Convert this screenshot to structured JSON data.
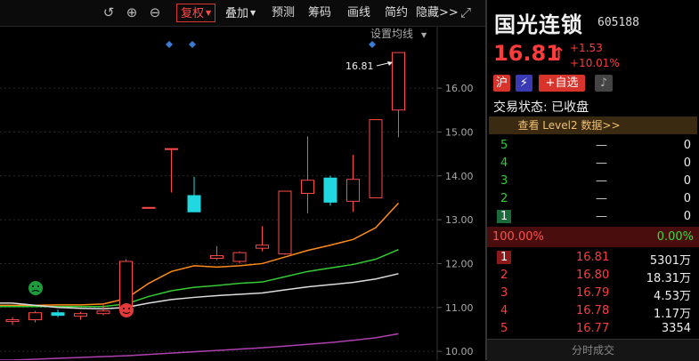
{
  "toolbar": {
    "icons": [
      "undo-icon",
      "zoom-in-icon",
      "zoom-out-icon"
    ],
    "items": [
      "复权",
      "叠加",
      "预测",
      "筹码",
      "画线",
      "简约",
      "隐藏>>"
    ],
    "active": "复权"
  },
  "chart": {
    "setting_label": "设置均线",
    "last_price_label": "16.81",
    "y_ticks": [
      "16.00",
      "15.00",
      "14.00",
      "13.00",
      "12.00",
      "11.00",
      "10.00"
    ]
  },
  "chart_data": {
    "type": "candlestick",
    "y_ticks": [
      16.0,
      15.0,
      14.0,
      13.0,
      12.0,
      11.0,
      10.0
    ],
    "ylim": [
      9.8,
      17.4
    ],
    "annotation": "16.81",
    "candles": [
      {
        "o": 10.72,
        "h": 10.78,
        "l": 10.6,
        "c": 10.68,
        "color": "red"
      },
      {
        "o": 10.72,
        "h": 10.92,
        "l": 10.66,
        "c": 10.88,
        "color": "red"
      },
      {
        "o": 10.88,
        "h": 10.95,
        "l": 10.78,
        "c": 10.82,
        "color": "cyan"
      },
      {
        "o": 10.8,
        "h": 10.9,
        "l": 10.72,
        "c": 10.86,
        "color": "red"
      },
      {
        "o": 10.86,
        "h": 11.1,
        "l": 10.82,
        "c": 10.92,
        "color": "red"
      },
      {
        "o": 10.92,
        "h": 12.1,
        "l": 10.9,
        "c": 12.05,
        "color": "red"
      },
      {
        "o": 13.28,
        "h": 13.28,
        "l": 13.28,
        "c": 13.28,
        "color": "red"
      },
      {
        "o": 14.6,
        "h": 14.62,
        "l": 13.62,
        "c": 14.62,
        "color": "red"
      },
      {
        "o": 13.55,
        "h": 13.98,
        "l": 13.18,
        "c": 13.18,
        "color": "cyan"
      },
      {
        "o": 12.12,
        "h": 12.4,
        "l": 12.08,
        "c": 12.18,
        "color": "red"
      },
      {
        "o": 12.05,
        "h": 12.28,
        "l": 12.0,
        "c": 12.25,
        "color": "red"
      },
      {
        "o": 12.35,
        "h": 12.85,
        "l": 12.28,
        "c": 12.42,
        "color": "red"
      },
      {
        "o": 12.22,
        "h": 13.65,
        "l": 12.2,
        "c": 13.65,
        "color": "red"
      },
      {
        "o": 13.6,
        "h": 14.9,
        "l": 13.15,
        "c": 13.9,
        "color": "red"
      },
      {
        "o": 13.95,
        "h": 14.0,
        "l": 13.32,
        "c": 13.4,
        "color": "cyan"
      },
      {
        "o": 13.42,
        "h": 14.48,
        "l": 13.18,
        "c": 13.92,
        "color": "red"
      },
      {
        "o": 13.5,
        "h": 15.28,
        "l": 13.5,
        "c": 15.28,
        "color": "red"
      },
      {
        "o": 15.5,
        "h": 16.81,
        "l": 14.88,
        "c": 16.81,
        "color": "red"
      }
    ],
    "series": [
      {
        "color": "#ff8c1a",
        "values": [
          11.05,
          11.05,
          11.06,
          11.06,
          11.08,
          11.2,
          11.55,
          11.82,
          11.95,
          11.92,
          11.95,
          12.0,
          12.15,
          12.3,
          12.42,
          12.55,
          12.82,
          13.38
        ]
      },
      {
        "color": "#33cc33",
        "values": [
          11.02,
          11.02,
          11.02,
          11.02,
          11.02,
          11.08,
          11.25,
          11.38,
          11.46,
          11.5,
          11.55,
          11.58,
          11.7,
          11.82,
          11.9,
          11.98,
          12.1,
          12.32
        ]
      },
      {
        "color": "#dddddd",
        "values": [
          11.1,
          11.05,
          11.0,
          10.98,
          10.97,
          11.0,
          11.1,
          11.18,
          11.23,
          11.27,
          11.3,
          11.33,
          11.4,
          11.47,
          11.52,
          11.57,
          11.65,
          11.77
        ]
      },
      {
        "color": "#b040b0",
        "values": [
          9.8,
          9.82,
          9.84,
          9.86,
          9.88,
          9.9,
          9.93,
          9.96,
          9.99,
          10.02,
          10.05,
          10.08,
          10.12,
          10.16,
          10.2,
          10.25,
          10.31,
          10.4
        ]
      }
    ]
  },
  "panel": {
    "name": "国光连锁",
    "code": "605188",
    "price": "16.81",
    "change": "+1.53",
    "pct": "+10.01%",
    "badges": {
      "market": "沪",
      "add": "+自选"
    },
    "status": "交易状态: 已收盘",
    "l2": "查看 Level2 数据>>",
    "asks": [
      {
        "level": "5",
        "price": "—",
        "vol": "0"
      },
      {
        "level": "4",
        "price": "—",
        "vol": "0"
      },
      {
        "level": "3",
        "price": "—",
        "vol": "0"
      },
      {
        "level": "2",
        "price": "—",
        "vol": "0"
      },
      {
        "level": "1",
        "price": "—",
        "vol": "0"
      }
    ],
    "ratio_left": "100.00%",
    "ratio_right": "0.00%",
    "bids": [
      {
        "level": "1",
        "price": "16.81",
        "vol": "5301万"
      },
      {
        "level": "2",
        "price": "16.80",
        "vol": "18.31万"
      },
      {
        "level": "3",
        "price": "16.79",
        "vol": "4.53万"
      },
      {
        "level": "4",
        "price": "16.78",
        "vol": "1.17万"
      },
      {
        "level": "5",
        "price": "16.77",
        "vol": "3354"
      }
    ],
    "footer": "分时成交"
  }
}
